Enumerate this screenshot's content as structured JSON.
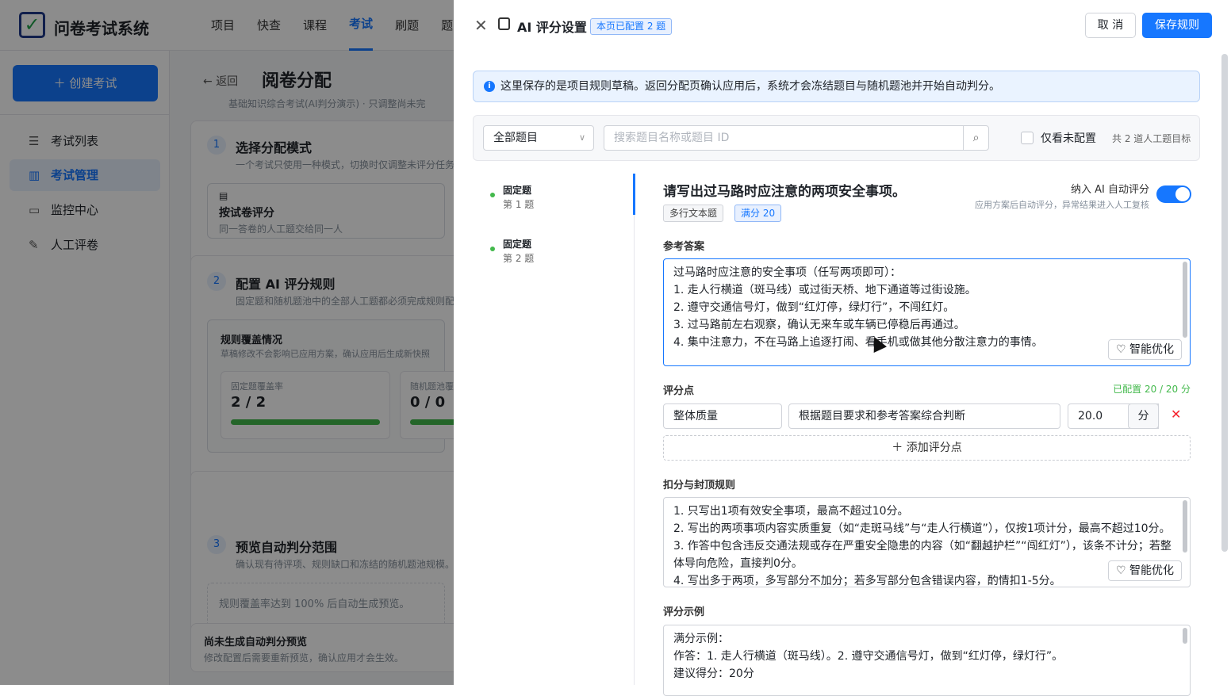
{
  "app": {
    "brand": "问卷考试系统",
    "nav": [
      "项目",
      "快查",
      "课程",
      "考试",
      "刷题",
      "题"
    ],
    "nav_active": 3,
    "create_button": "＋ 创建考试",
    "sidebar": [
      {
        "label": "考试列表",
        "icon": "list-icon"
      },
      {
        "label": "考试管理",
        "icon": "book-icon",
        "active": true
      },
      {
        "label": "监控中心",
        "icon": "monitor-icon"
      },
      {
        "label": "人工评卷",
        "icon": "edit-icon"
      }
    ]
  },
  "page": {
    "back": "返回",
    "title": "阅卷分配",
    "subtitle": "基础知识综合考试(AI判分演示) · 只调整尚未完",
    "step1": {
      "num": "1",
      "title": "选择分配模式",
      "desc": "一个考试只使用一种模式，切换时仅调整未评分任务",
      "option_title": "按试卷评分",
      "option_desc": "同一答卷的人工题交给同一人"
    },
    "step2": {
      "num": "2",
      "title": "配置 AI 评分规则",
      "desc": "固定题和随机题池中的全部人工题都必须完成规则配",
      "coverage_title": "规则覆盖情况",
      "coverage_desc": "草稿修改不会影响已应用方案，确认应用后生成新快照",
      "fixed_label": "固定题覆盖率",
      "fixed_value": "2 / 2",
      "fixed_progress": 1.0,
      "random_label": "随机题池覆",
      "random_value": "0 / 0",
      "random_progress": 1.0
    },
    "step3": {
      "num": "3",
      "title": "预览自动判分范围",
      "desc": "确认现有待评项、规则缺口和冻结的随机题池规模。",
      "placeholder": "规则覆盖率达到 100% 后自动生成预览。"
    },
    "footer": {
      "title": "尚未生成自动判分预览",
      "desc": "修改配置后需要重新预览，确认应用才会生效。"
    }
  },
  "drawer": {
    "title": "AI 评分设置",
    "badge": "本页已配置 2 题",
    "cancel": "取 消",
    "save": "保存规则",
    "info": "这里保存的是项目规则草稿。返回分配页确认应用后，系统才会冻结题目与随机题池并开始自动判分。",
    "filter": {
      "select": "全部题目",
      "search_placeholder": "搜索题目名称或题目 ID",
      "only_unconfigured": "仅看未配置",
      "total": "共 2 道人工题目标"
    },
    "questions": [
      {
        "type": "固定题",
        "index": "第 1 题"
      },
      {
        "type": "固定题",
        "index": "第 2 题"
      }
    ],
    "question": {
      "title": "请写出过马路时应注意的两项安全事项。",
      "type_tag": "多行文本题",
      "score_tag": "满分 20",
      "ai_include": "纳入 AI 自动评分",
      "ai_desc": "应用方案后自动评分，异常结果进入人工复核",
      "ai_enabled": true
    },
    "reference": {
      "label": "参考答案",
      "lines": [
        "过马路时应注意的安全事项（任写两项即可）：",
        "1. 走人行横道（斑马线）或过街天桥、地下通道等过街设施。",
        "2. 遵守交通信号灯，做到“红灯停，绿灯行”，不闯红灯。",
        "3. 过马路前左右观察，确认无来车或车辆已停稳后再通过。",
        "4. 集中注意力，不在马路上追逐打闹、看手机或做其他分散注意力的事情。"
      ],
      "smart": "智能优化"
    },
    "points": {
      "label": "评分点",
      "configured": "已配置 20 / 20 分",
      "name": "整体质量",
      "criteria": "根据题目要求和参考答案综合判断",
      "score": "20.0",
      "unit": "分",
      "add": "＋ 添加评分点"
    },
    "deduction": {
      "label": "扣分与封顶规则",
      "lines": [
        "1. 只写出1项有效安全事项，最高不超过10分。",
        "2. 写出的两项事项内容实质重复（如“走斑马线”与“走人行横道”），仅按1项计分，最高不超过10分。",
        "3. 作答中包含违反交通法规或存在严重安全隐患的内容（如“翻越护栏”“闯红灯”），该条不计分；若整",
        "体导向危险，直接判0分。",
        "4. 写出多于两项，多写部分不加分；若多写部分包含错误内容，酌情扣1-5分。"
      ],
      "smart": "智能优化"
    },
    "examples": {
      "label": "评分示例",
      "lines": [
        "满分示例：",
        "作答：1. 走人行横道（斑马线）。2. 遵守交通信号灯，做到“红灯停，绿灯行”。",
        "建议得分：20分"
      ]
    }
  },
  "colors": {
    "primary": "#1677ff",
    "success": "#43b94c",
    "danger": "#f5222d"
  }
}
